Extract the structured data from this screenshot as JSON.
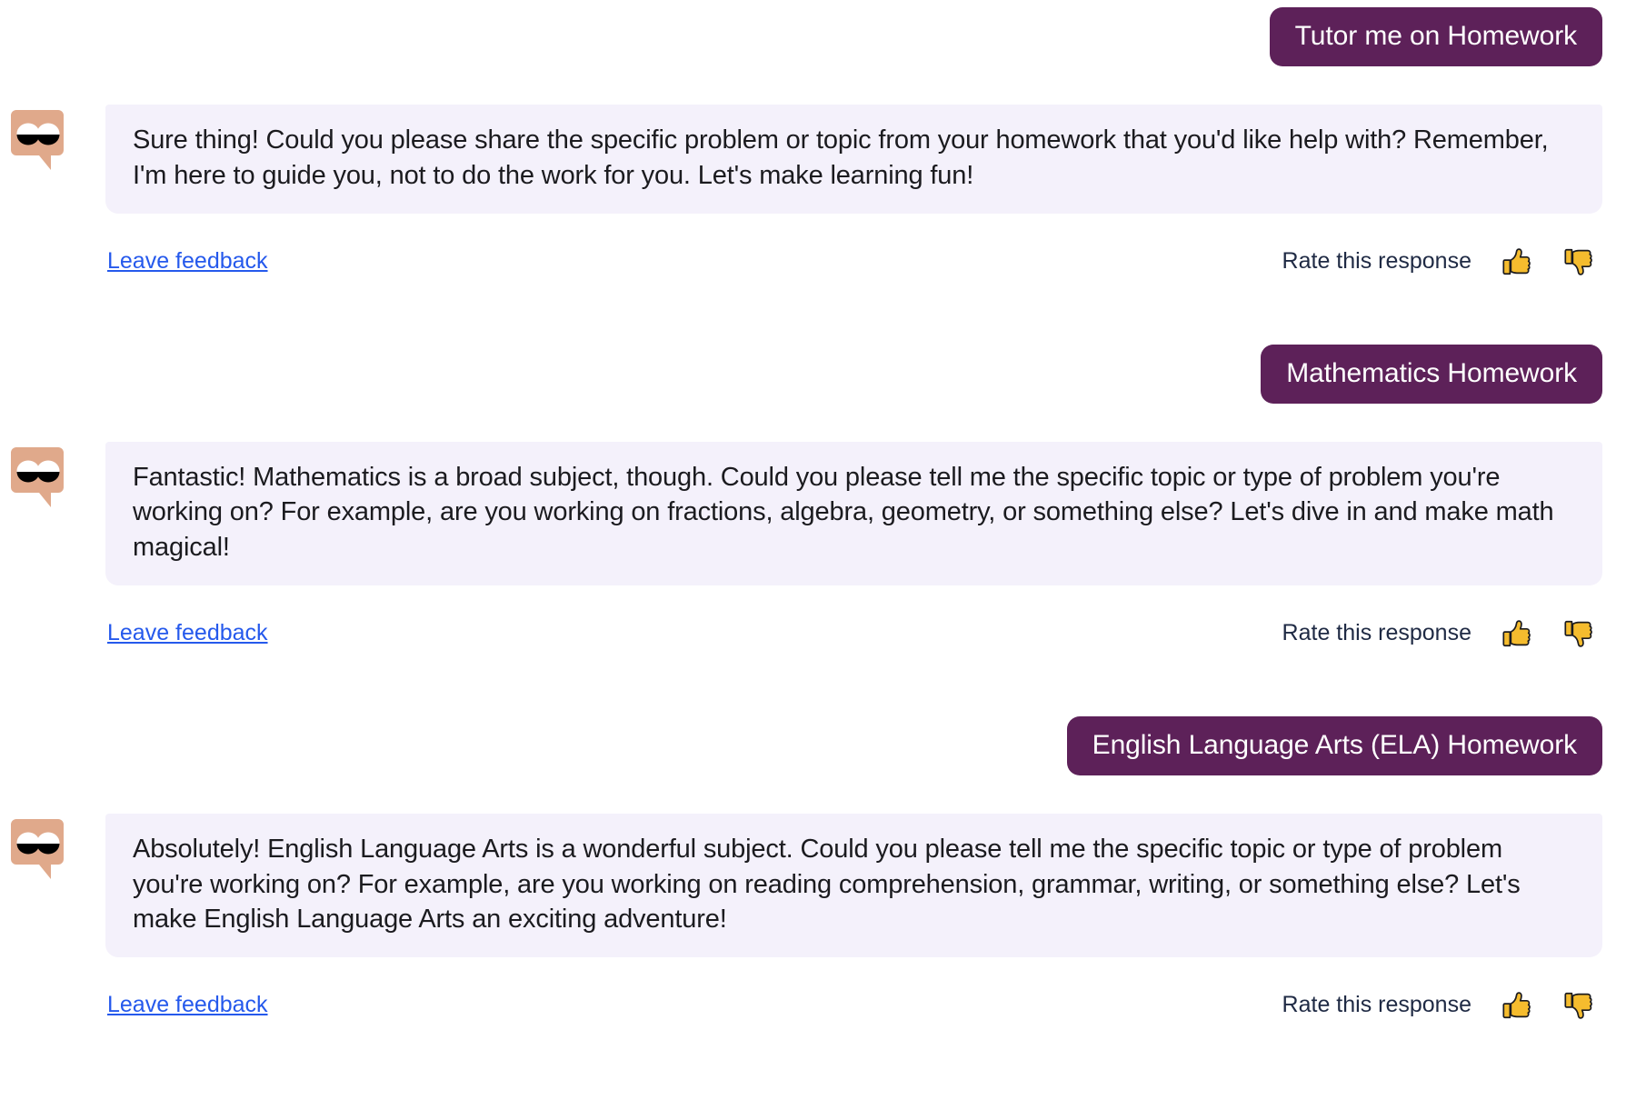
{
  "theme": {
    "user_bubble_bg": "#5d2159",
    "user_bubble_text": "#ffffff",
    "bot_bubble_bg": "#f4f1fb",
    "bot_bubble_text": "#1b1b1f",
    "link_color": "#2559ec",
    "avatar_bg": "#e0a98b",
    "thumb_color": "#f5bc2e",
    "page_bg": "#ffffff"
  },
  "labels": {
    "leave_feedback": "Leave feedback",
    "rate_this_response": "Rate this response",
    "thumbs_up_icon": "thumbs-up-icon",
    "thumbs_down_icon": "thumbs-down-icon",
    "avatar_icon": "bot-avatar-eyes-icon"
  },
  "messages": [
    {
      "role": "user",
      "text": "Tutor me on Homework"
    },
    {
      "role": "bot",
      "text": "Sure thing! Could you please share the specific problem or topic from your homework that you'd like help with? Remember, I'm here to guide you, not to do the work for you. Let's make learning fun!",
      "has_feedback": true
    },
    {
      "role": "user",
      "text": "Mathematics Homework"
    },
    {
      "role": "bot",
      "text": "Fantastic! Mathematics is a broad subject, though. Could you please tell me the specific topic or type of problem you're working on? For example, are you working on fractions, algebra, geometry, or something else? Let's dive in and make math magical!",
      "has_feedback": true
    },
    {
      "role": "user",
      "text": "English Language Arts (ELA) Homework"
    },
    {
      "role": "bot",
      "text": "Absolutely! English Language Arts is a wonderful subject. Could you please tell me the specific topic or type of problem you're working on? For example, are you working on reading comprehension, grammar, writing, or something else? Let's make English Language Arts an exciting adventure!",
      "has_feedback": true
    }
  ]
}
